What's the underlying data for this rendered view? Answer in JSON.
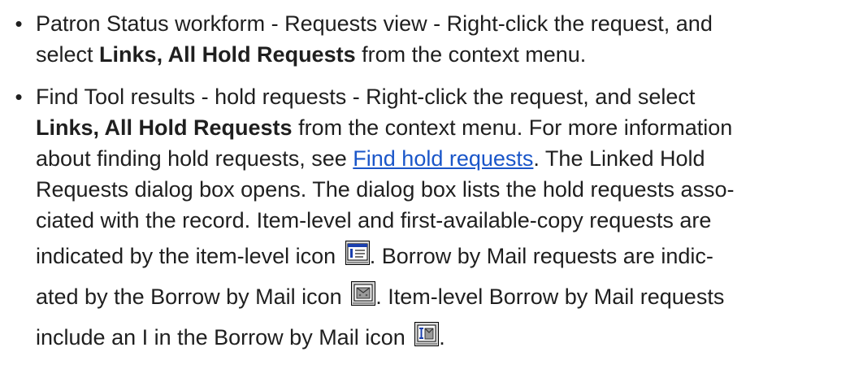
{
  "bullets": [
    {
      "lines": [
        {
          "text": "Patron Status workform - Requests view - Right-click the request, and"
        },
        {
          "pre": "select ",
          "bold": "Links, All Hold Requests",
          "post": " from the context menu."
        }
      ]
    },
    {
      "lines": [
        {
          "text": "Find Tool results - hold requests - Right-click the request, and select"
        },
        {
          "bold": "Links, All Hold Requests",
          "post": " from the context menu. For more information"
        },
        {
          "pre": "about finding hold requests, see ",
          "link": "Find hold requests",
          "post": ". The Linked Hold"
        },
        {
          "text": "Requests dialog box opens. The dialog box lists the hold requests asso-"
        },
        {
          "text": "ciated with the record. Item-level and first-available-copy requests are"
        },
        {
          "pre": "indicated by the item-level icon ",
          "post": ". Borrow by Mail requests are indic-"
        },
        {
          "pre": "ated by the Borrow by Mail icon ",
          "post": ". Item-level Borrow by Mail requests"
        },
        {
          "pre": "include an I in the Borrow by Mail icon ",
          "post": "."
        }
      ]
    }
  ],
  "icons": {
    "item_level": "item-level-request-icon",
    "borrow_by_mail": "borrow-by-mail-icon",
    "item_level_borrow_by_mail": "item-level-borrow-by-mail-icon"
  },
  "colors": {
    "text": "#1f1f1f",
    "link": "#1a56c9"
  }
}
